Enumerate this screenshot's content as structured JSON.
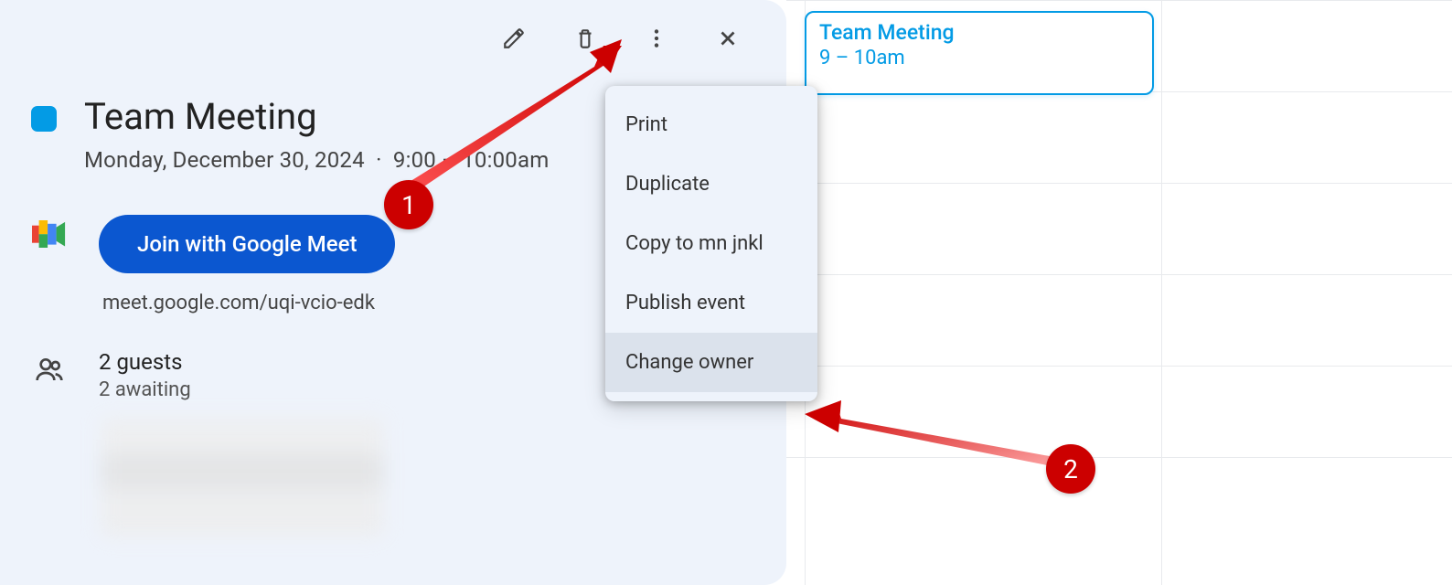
{
  "event": {
    "title": "Team Meeting",
    "date": "Monday, December 30, 2024",
    "time": "9:00 – 10:00am",
    "color": "#039be5"
  },
  "meet": {
    "join_label": "Join with Google Meet",
    "link": "meet.google.com/uqi-vcio-edk"
  },
  "guests": {
    "count_label": "2 guests",
    "status_label": "2 awaiting"
  },
  "menu": {
    "items": [
      "Print",
      "Duplicate",
      "Copy to mn jnkl",
      "Publish event",
      "Change owner"
    ],
    "highlight_index": 4
  },
  "calendar_block": {
    "title": "Team Meeting",
    "time": "9 – 10am"
  },
  "annotations": {
    "badge1": "1",
    "badge2": "2"
  }
}
